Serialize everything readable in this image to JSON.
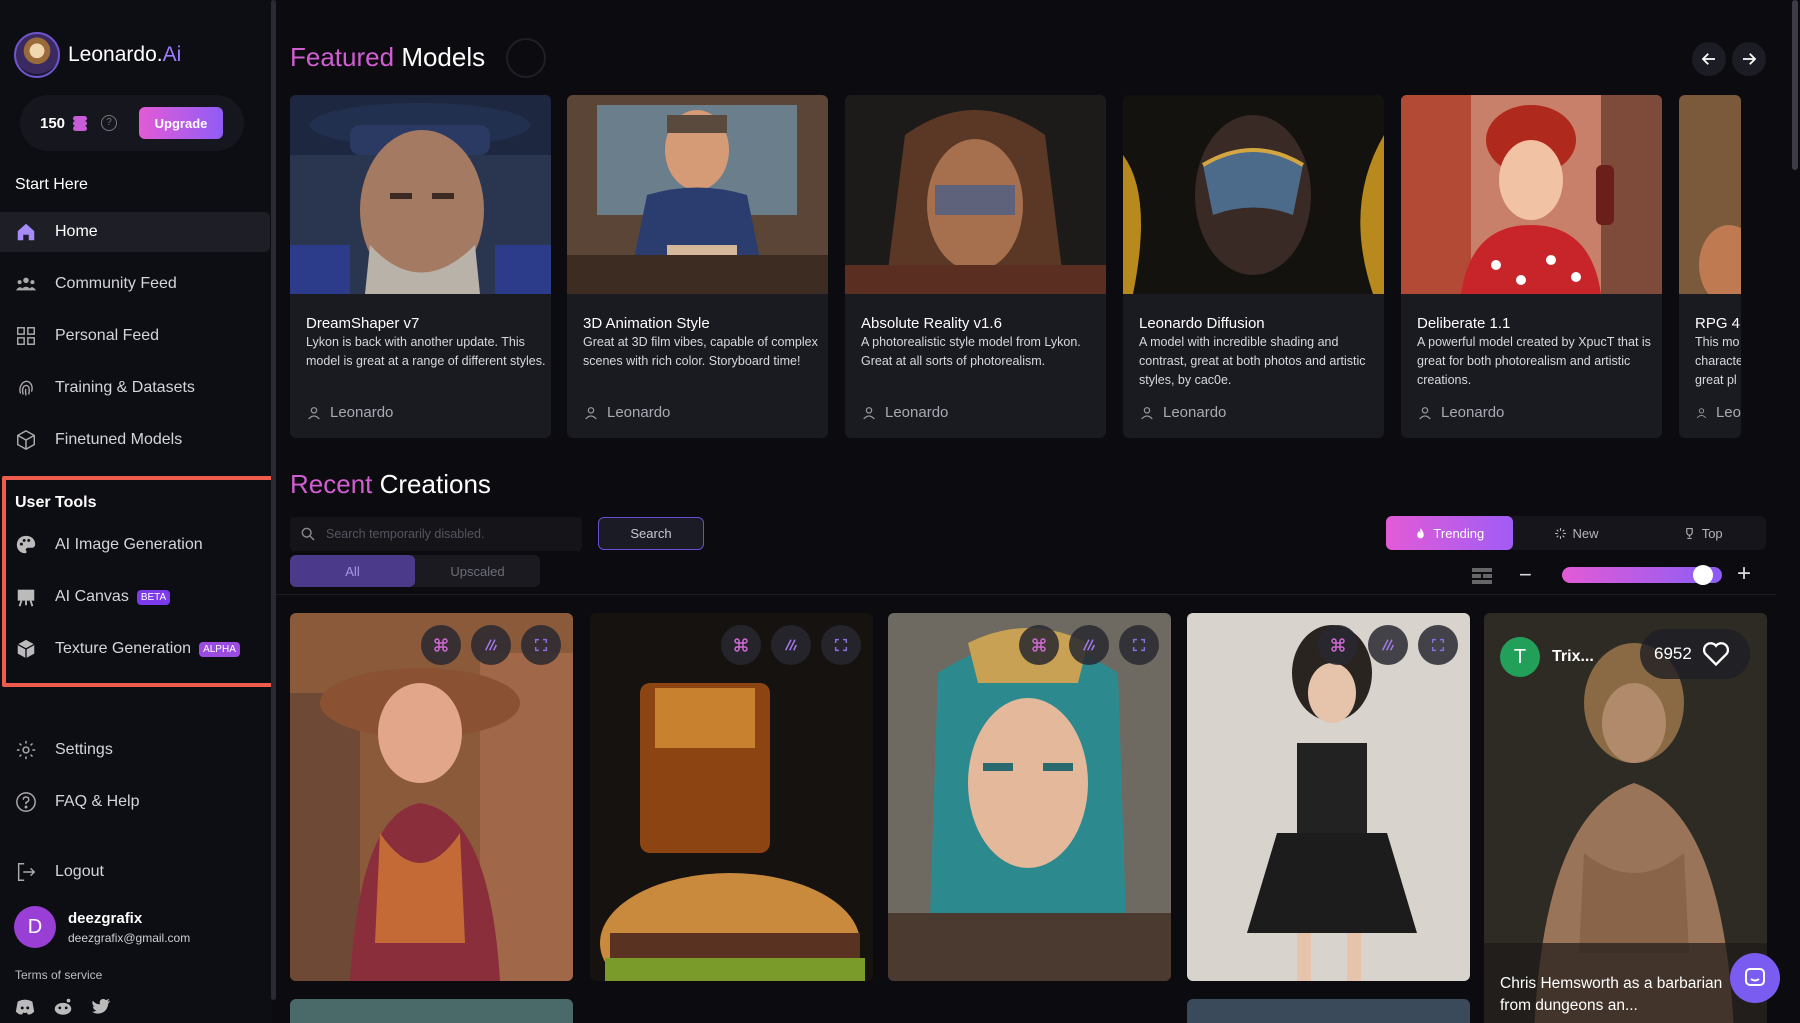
{
  "brand": {
    "name": "Leonardo.",
    "name_suffix": "Ai"
  },
  "credits": {
    "amount": "150",
    "upgrade_label": "Upgrade"
  },
  "sidebar": {
    "start_here": "Start Here",
    "nav": [
      {
        "label": "Home",
        "icon": "home-icon"
      },
      {
        "label": "Community Feed",
        "icon": "community-icon"
      },
      {
        "label": "Personal Feed",
        "icon": "grid-icon"
      },
      {
        "label": "Training & Datasets",
        "icon": "fingerprint-icon"
      },
      {
        "label": "Finetuned Models",
        "icon": "cube-icon"
      }
    ],
    "user_tools_label": "User Tools",
    "tools": [
      {
        "label": "AI Image Generation",
        "icon": "palette-icon"
      },
      {
        "label": "AI Canvas",
        "icon": "easel-icon",
        "badge": "BETA"
      },
      {
        "label": "Texture Generation",
        "icon": "texture-cube-icon",
        "badge": "ALPHA"
      }
    ],
    "settings_label": "Settings",
    "faq_label": "FAQ & Help",
    "logout_label": "Logout",
    "user": {
      "initial": "D",
      "name": "deezgrafix",
      "email": "deezgrafix@gmail.com"
    },
    "terms_label": "Terms of service",
    "social_icons": [
      "discord-icon",
      "reddit-icon",
      "twitter-icon"
    ]
  },
  "featured": {
    "title_accent": "Featured",
    "title_rest": "Models",
    "models": [
      {
        "name": "DreamShaper v7",
        "desc": "Lykon is back with another update. This model is great at a range of different styles.",
        "author": "Leonardo"
      },
      {
        "name": "3D Animation Style",
        "desc": "Great at 3D film vibes, capable of complex scenes with rich color. Storyboard time!",
        "author": "Leonardo"
      },
      {
        "name": "Absolute Reality v1.6",
        "desc": "A photorealistic style model from Lykon. Great at all sorts of photorealism.",
        "author": "Leonardo"
      },
      {
        "name": "Leonardo Diffusion",
        "desc": "A model with incredible shading and contrast, great at both photos and artistic styles, by cac0e.",
        "author": "Leonardo"
      },
      {
        "name": "Deliberate 1.1",
        "desc": "A powerful model created by XpucT that is great for both photorealism and artistic creations.",
        "author": "Leonardo"
      },
      {
        "name": "RPG 4",
        "desc": "This mo characte great pl",
        "author": "Leo"
      }
    ]
  },
  "recent": {
    "title_accent": "Recent",
    "title_rest": "Creations",
    "search_placeholder": "Search temporarily disabled.",
    "search_button": "Search",
    "filter_tabs": [
      "All",
      "Upscaled"
    ],
    "sort_tabs": [
      {
        "label": "Trending",
        "icon": "flame-icon"
      },
      {
        "label": "New",
        "icon": "sparkle-icon"
      },
      {
        "label": "Top",
        "icon": "trophy-icon"
      }
    ],
    "zoom_minus": "−",
    "zoom_plus": "+",
    "zoom_level": 0.88,
    "featured_creation": {
      "user_initial": "T",
      "user_name": "Trix...",
      "likes": "6952",
      "caption": "Chris Hemsworth as a barbarian from dungeons an..."
    }
  },
  "colors": {
    "accent_pink": "#d15ed1",
    "accent_purple": "#8b5cf6",
    "highlight": "#ef5c4d",
    "bg": "#0b0b10"
  }
}
